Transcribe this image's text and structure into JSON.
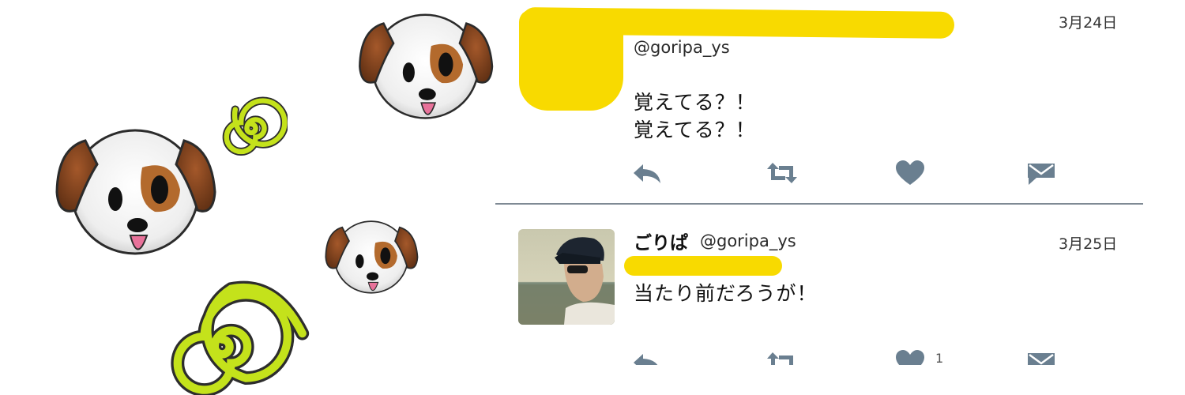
{
  "tweet1": {
    "handle": "@goripa_ys",
    "date": "3月24日",
    "lines": [
      "覚えてる？！",
      "覚えてる？！"
    ]
  },
  "tweet2": {
    "name": "ごりぱ",
    "handle": "@goripa_ys",
    "date": "3月25日",
    "text": "当たり前だろうが！",
    "like_count": "1"
  },
  "icons": {
    "reply": "reply-icon",
    "retweet": "retweet-icon",
    "like": "heart-icon",
    "dm": "direct-message-icon"
  },
  "colors": {
    "marker_yellow": "#f8da00",
    "icon_gray": "#6a7f90",
    "spiral_green": "#c4e21b"
  }
}
